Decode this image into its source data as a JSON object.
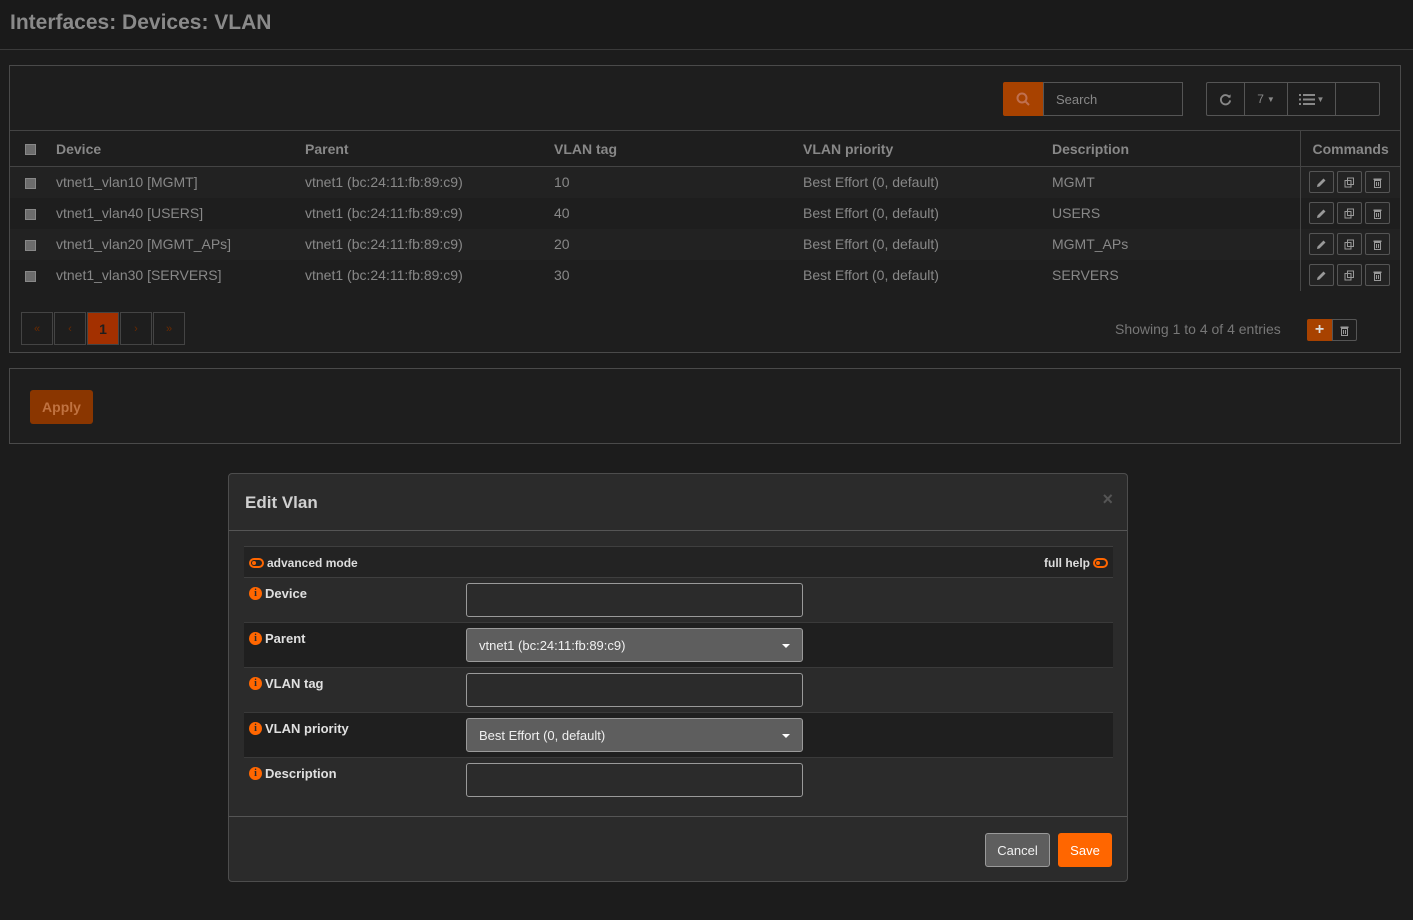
{
  "page": {
    "title": "Interfaces: Devices: VLAN"
  },
  "toolbar": {
    "search_placeholder": "Search",
    "row_count": "7",
    "refresh_icon": "refresh-icon",
    "columns_icon": "list-icon"
  },
  "grid": {
    "headers": [
      "Device",
      "Parent",
      "VLAN tag",
      "VLAN priority",
      "Description",
      "Commands"
    ],
    "rows": [
      {
        "device": "vtnet1_vlan10 [MGMT]",
        "parent": "vtnet1 (bc:24:11:fb:89:c9)",
        "tag": "10",
        "priority": "Best Effort (0, default)",
        "description": "MGMT"
      },
      {
        "device": "vtnet1_vlan40 [USERS]",
        "parent": "vtnet1 (bc:24:11:fb:89:c9)",
        "tag": "40",
        "priority": "Best Effort (0, default)",
        "description": "USERS"
      },
      {
        "device": "vtnet1_vlan20 [MGMT_APs]",
        "parent": "vtnet1 (bc:24:11:fb:89:c9)",
        "tag": "20",
        "priority": "Best Effort (0, default)",
        "description": "MGMT_APs"
      },
      {
        "device": "vtnet1_vlan30 [SERVERS]",
        "parent": "vtnet1 (bc:24:11:fb:89:c9)",
        "tag": "30",
        "priority": "Best Effort (0, default)",
        "description": "SERVERS"
      }
    ]
  },
  "pager": {
    "first": "«",
    "prev": "‹",
    "current": "1",
    "next": "›",
    "last": "»",
    "showing": "Showing 1 to 4 of 4 entries",
    "add_label": "+"
  },
  "apply": {
    "label": "Apply"
  },
  "modal": {
    "title": "Edit Vlan",
    "close": "×",
    "advanced_mode": "advanced mode",
    "full_help": "full help",
    "fields": {
      "device": {
        "label": "Device",
        "value": ""
      },
      "parent": {
        "label": "Parent",
        "value": "vtnet1 (bc:24:11:fb:89:c9)"
      },
      "tag": {
        "label": "VLAN tag",
        "value": ""
      },
      "priority": {
        "label": "VLAN priority",
        "value": "Best Effort (0, default)"
      },
      "description": {
        "label": "Description",
        "value": ""
      }
    },
    "cancel": "Cancel",
    "save": "Save"
  },
  "colors": {
    "accent": "#ff6600",
    "dim_accent": "#a84200",
    "background": "#1c1c1c",
    "modal": "#2b2b2b"
  }
}
